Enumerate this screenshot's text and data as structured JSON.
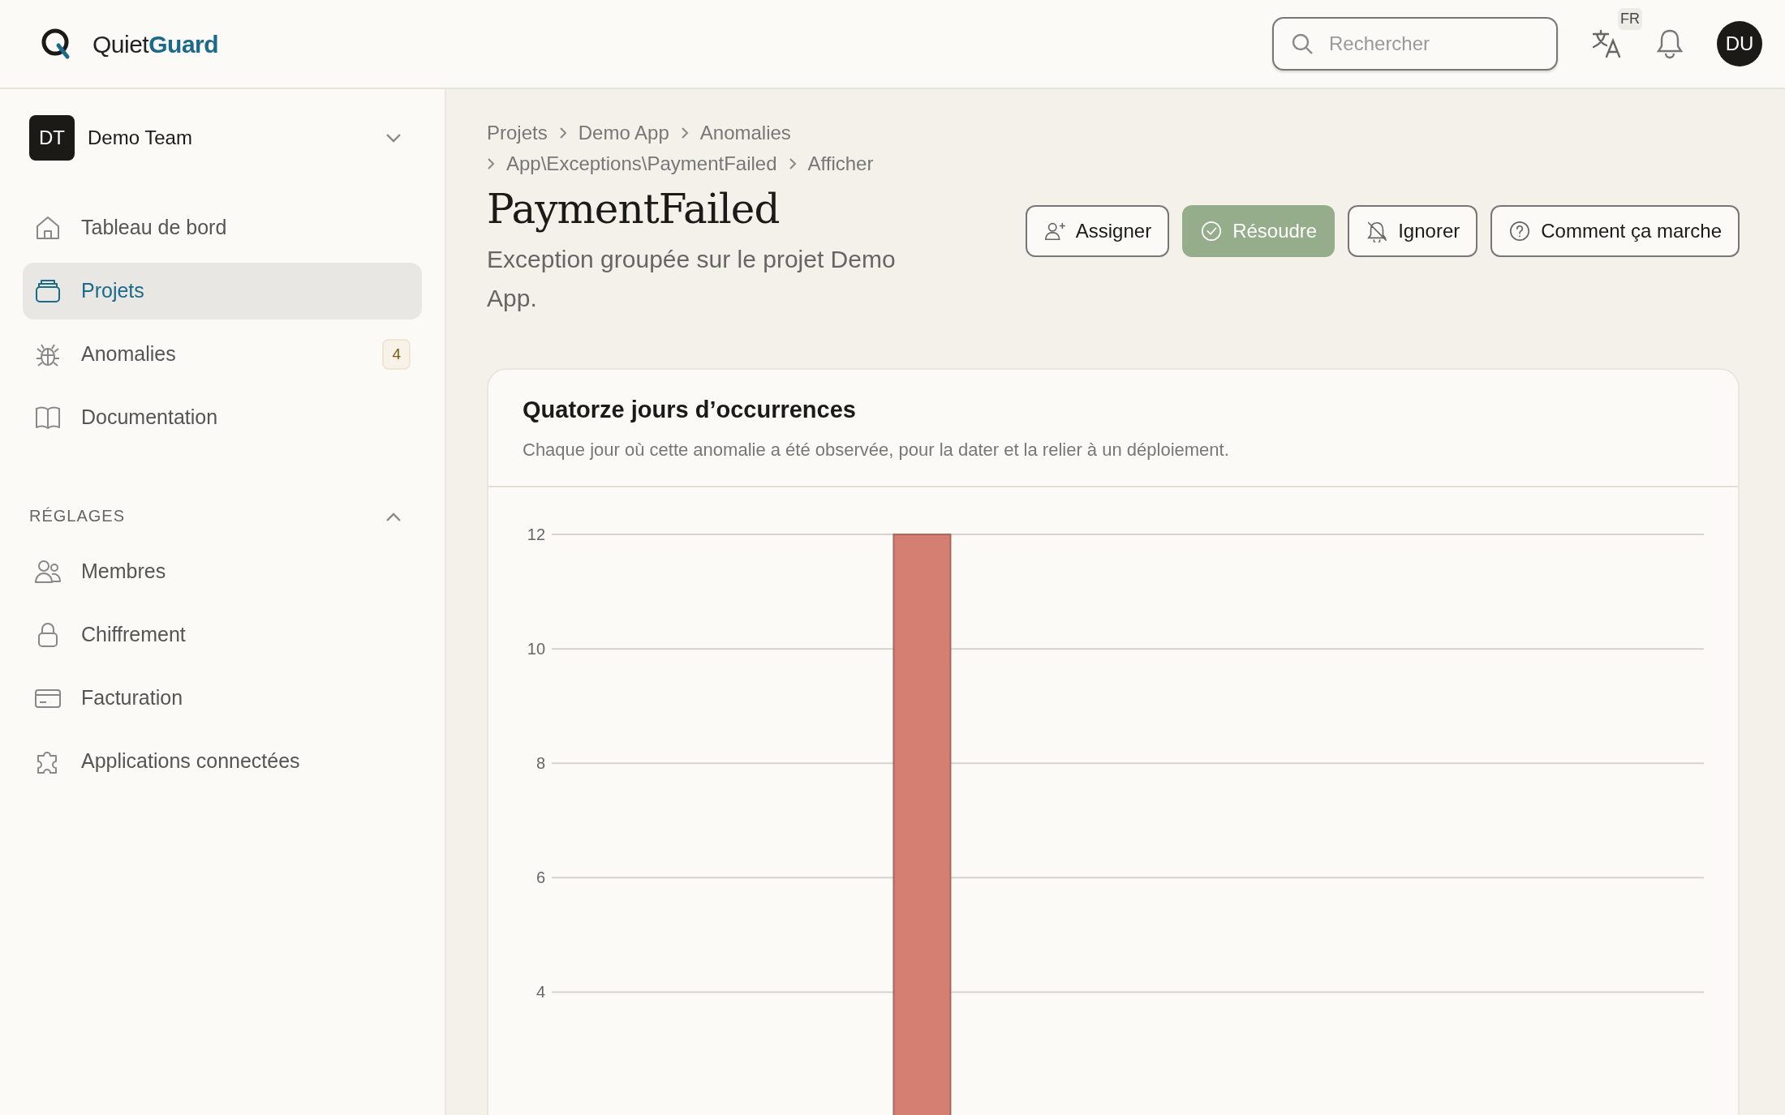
{
  "app": {
    "logo_part1": "Quiet",
    "logo_part2": "Guard"
  },
  "search": {
    "placeholder": "Rechercher"
  },
  "language": "FR",
  "user_initials": "DU",
  "team": {
    "initials": "DT",
    "name": "Demo Team"
  },
  "nav": [
    {
      "label": "Tableau de bord",
      "selected": false
    },
    {
      "label": "Projets",
      "selected": true
    },
    {
      "label": "Anomalies",
      "selected": false,
      "badge": "4"
    },
    {
      "label": "Documentation",
      "selected": false
    }
  ],
  "settings_section": {
    "title": "RÉGLAGES",
    "expanded": true,
    "items": [
      {
        "label": "Membres",
        "selected": false
      },
      {
        "label": "Chiffrement",
        "selected": false
      },
      {
        "label": "Facturation",
        "selected": false
      },
      {
        "label": "Applications connectées",
        "selected": false
      }
    ]
  },
  "breadcrumb": [
    "Projets",
    "Demo App",
    "Anomalies",
    "App\\Exceptions\\PaymentFailed",
    "Afficher"
  ],
  "page": {
    "title": "PaymentFailed",
    "subtitle": "Exception groupée sur le projet Demo App."
  },
  "actions": [
    {
      "label": "Assigner",
      "kind": "outline"
    },
    {
      "label": "Résoudre",
      "kind": "primary"
    },
    {
      "label": "Ignorer",
      "kind": "outline"
    },
    {
      "label": "Comment ça marche",
      "kind": "outline"
    }
  ],
  "chart_card": {
    "title": "Quatorze jours d’occurrences",
    "subtitle": "Chaque jour où cette anomalie a été observée, pour la dater et la relier à un déploiement.",
    "chart_data": {
      "type": "bar",
      "ylim": [
        0,
        12
      ],
      "yticks": [
        4,
        6,
        8,
        10,
        12
      ],
      "grid": true,
      "series": [
        {
          "color": "#d47f72",
          "values": [
            0,
            0,
            0,
            0,
            12,
            0,
            0,
            0,
            0,
            0,
            0,
            0,
            0,
            0
          ]
        }
      ]
    }
  }
}
